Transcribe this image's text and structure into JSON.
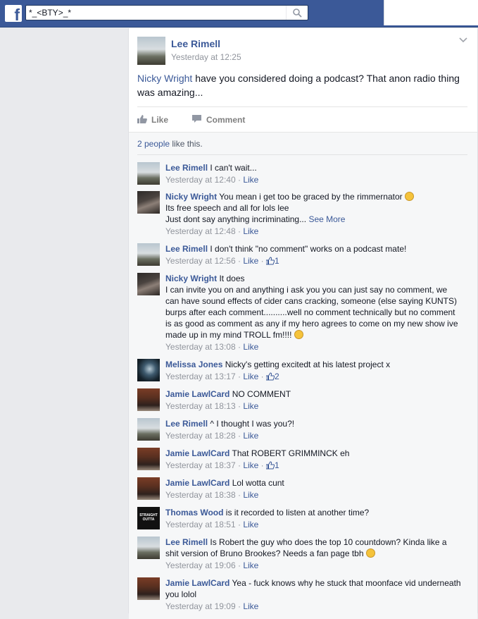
{
  "topbar": {
    "logo": "f",
    "search_value": "*_<BTY>_*",
    "search_icon": "search-icon"
  },
  "post": {
    "author": "Lee Rimell",
    "timestamp": "Yesterday at 12:25",
    "mention": "Nicky Wright",
    "text_rest": " have you considered doing a podcast? That anon radio thing was amazing...",
    "like_label": "Like",
    "comment_label": "Comment"
  },
  "likes": {
    "count_link": "2 people",
    "suffix": " like this."
  },
  "comments": [
    {
      "author": "Lee Rimell",
      "text": "I can't wait...",
      "time": "Yesterday at 12:40",
      "like": "Like",
      "likes": ""
    },
    {
      "author": "Nicky Wright",
      "text": "You mean i get too be graced by the rimmernator",
      "line2": "Its free speech and all for lols lee",
      "line3": "Just dont say anything incriminating...",
      "see_more": "See More",
      "time": "Yesterday at 12:48",
      "like": "Like",
      "likes": ""
    },
    {
      "author": "Lee Rimell",
      "text": "I don't think \"no comment\" works on a podcast mate!",
      "time": "Yesterday at 12:56",
      "like": "Like",
      "likes": "1"
    },
    {
      "author": "Nicky Wright",
      "text": "It does",
      "line2": "I can invite you on and anything i ask you you can just say no comment, we can have sound effects of cider cans cracking, someone (else saying KUNTS) burps after each comment..........well no comment technically but no comment is as good as comment as any if my hero agrees to come on my new show ive made up in my mind TROLL fm!!!!",
      "time": "Yesterday at 13:08",
      "like": "Like",
      "likes": ""
    },
    {
      "author": "Melissa Jones",
      "text": "Nicky's getting excitedt at his latest project x",
      "time": "Yesterday at 13:17",
      "like": "Like",
      "likes": "2"
    },
    {
      "author": "Jamie LawlCard",
      "text": "NO COMMENT",
      "time": "Yesterday at 18:13",
      "like": "Like",
      "likes": ""
    },
    {
      "author": "Lee Rimell",
      "text": "^ I thought I was you?!",
      "time": "Yesterday at 18:28",
      "like": "Like",
      "likes": ""
    },
    {
      "author": "Jamie LawlCard",
      "text": "That ROBERT GRIMMINCK eh",
      "time": "Yesterday at 18:37",
      "like": "Like",
      "likes": "1"
    },
    {
      "author": "Jamie LawlCard",
      "text": "Lol wotta cunt",
      "time": "Yesterday at 18:38",
      "like": "Like",
      "likes": ""
    },
    {
      "author": "Thomas Wood",
      "text": "is it recorded to listen at another time?",
      "time": "Yesterday at 18:51",
      "like": "Like",
      "likes": "",
      "avatar_text": "STRAIGHT OUTTA"
    },
    {
      "author": "Lee Rimell",
      "text": "Is Robert the guy who does the top 10 countdown? Kinda like a shit version of Bruno Brookes? Needs a fan page tbh",
      "time": "Yesterday at 19:06",
      "like": "Like",
      "likes": ""
    },
    {
      "author": "Jamie LawlCard",
      "text": "Yea - fuck knows why he stuck that moonface vid underneath you lolol",
      "time": "Yesterday at 19:09",
      "like": "Like",
      "likes": ""
    }
  ],
  "colors": {
    "brand": "#3b5998",
    "background": "#e9eaed",
    "meta": "#90949c"
  }
}
